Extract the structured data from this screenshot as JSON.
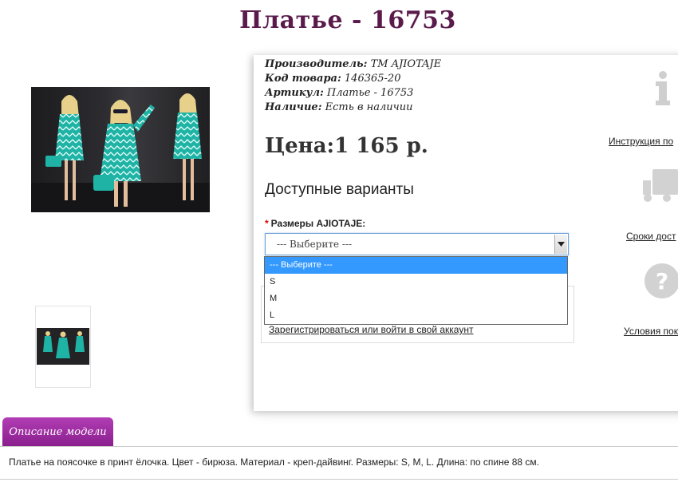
{
  "product": {
    "title": "Платье - 16753"
  },
  "specs": [
    {
      "label": "Производитель:",
      "value": "ТМ AJIOTAJE"
    },
    {
      "label": "Код товара:",
      "value": "146365-20"
    },
    {
      "label": "Артикул:",
      "value": "Платье - 16753"
    },
    {
      "label": "Наличие:",
      "value": "Есть в наличии"
    }
  ],
  "price": {
    "text": "Цена:1 165 р."
  },
  "options": {
    "heading": "Доступные варианты",
    "size_label": "Размеры AJIOTAJE:",
    "required_mark": "*",
    "select_value": "--- Выберите ---",
    "dropdown_items": [
      "--- Выберите ---",
      "S",
      "M",
      "L"
    ]
  },
  "login": {
    "link_text": "Зарегистрироваться или войти в свой аккаунт"
  },
  "right_column": {
    "links": [
      "Инструкция по",
      "Сроки дост",
      "Условия пок"
    ],
    "icons": [
      "info-icon",
      "truck-icon",
      "question-icon"
    ]
  },
  "tabs": {
    "description_label": "Описание модели"
  },
  "description": {
    "text": "Платье на поясочке в принт ёлочка. Цвет - бирюза. Материал - креп-дайвинг. Размеры: S, M, L. Длина: по спине 88 см."
  },
  "colors": {
    "title": "#5a1a4a",
    "tab": "#9c2aa0",
    "select_highlight": "#3399ff",
    "dress": "#1fb3a6"
  }
}
